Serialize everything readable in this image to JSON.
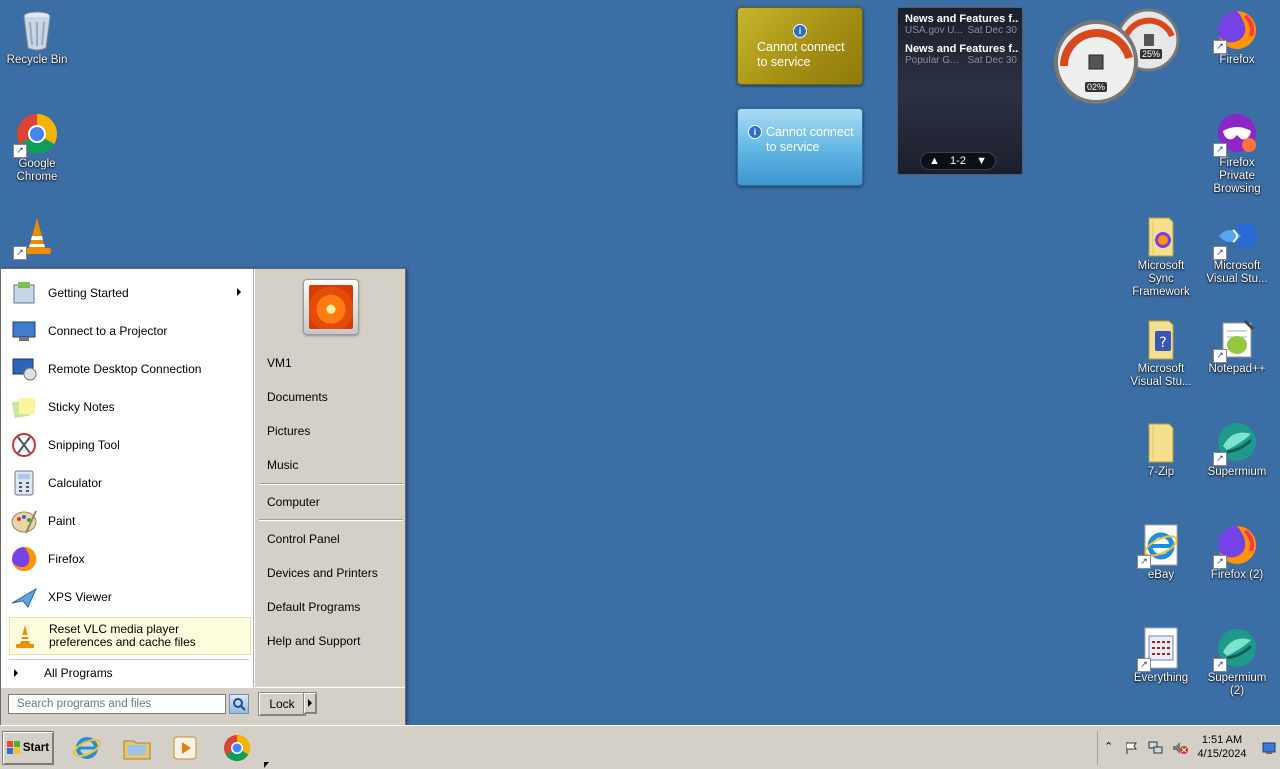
{
  "desktop": {
    "left_icons": [
      {
        "label": "Recycle Bin",
        "icon": "recycle-bin-icon"
      },
      {
        "label": "Google Chrome",
        "icon": "chrome-icon"
      },
      {
        "label": "VLC media player",
        "icon": "vlc-icon"
      }
    ],
    "right_icons": [
      {
        "label": "Firefox",
        "icon": "firefox-icon"
      },
      {
        "label": "Firefox Private Browsing",
        "icon": "firefox-private-icon"
      },
      {
        "label": "Microsoft Sync Framework",
        "icon": "folder-icon"
      },
      {
        "label": "Microsoft Visual Stu...",
        "icon": "visual-studio-icon"
      },
      {
        "label": "Microsoft Visual Stu...",
        "icon": "folder-help-icon"
      },
      {
        "label": "Notepad++",
        "icon": "notepadpp-icon"
      },
      {
        "label": "7-Zip",
        "icon": "folder-icon"
      },
      {
        "label": "Supermium",
        "icon": "supermium-icon"
      },
      {
        "label": "eBay",
        "icon": "ie-icon"
      },
      {
        "label": "Firefox (2)",
        "icon": "firefox-icon"
      },
      {
        "label": "Everything",
        "icon": "everything-icon"
      },
      {
        "label": "Supermium (2)",
        "icon": "supermium-icon"
      }
    ]
  },
  "gadgets": {
    "weather1": {
      "text": "Cannot connect to service"
    },
    "weather2": {
      "text": "Cannot connect to service"
    },
    "feed": {
      "items": [
        {
          "title": "News and Features f...",
          "source": "USA.gov U...",
          "date": "Sat Dec 30"
        },
        {
          "title": "News and Features f...",
          "source": "Popular G...",
          "date": "Sat Dec 30"
        }
      ],
      "pager": "1-2"
    },
    "meter": {
      "cpu": "02%",
      "memory": "25%"
    }
  },
  "start_menu": {
    "programs": [
      {
        "label": "Getting Started",
        "icon": "getting-started-icon",
        "has_submenu": true
      },
      {
        "label": "Connect to a Projector",
        "icon": "projector-icon"
      },
      {
        "label": "Remote Desktop Connection",
        "icon": "remote-desktop-icon"
      },
      {
        "label": "Sticky Notes",
        "icon": "sticky-notes-icon"
      },
      {
        "label": "Snipping Tool",
        "icon": "snipping-tool-icon"
      },
      {
        "label": "Calculator",
        "icon": "calculator-icon"
      },
      {
        "label": "Paint",
        "icon": "paint-icon"
      },
      {
        "label": "Firefox",
        "icon": "firefox-icon"
      },
      {
        "label": "XPS Viewer",
        "icon": "xps-viewer-icon"
      },
      {
        "label": "Reset VLC media player preferences and cache files",
        "icon": "vlc-icon",
        "highlighted": true
      }
    ],
    "all_programs": "All Programs",
    "search_placeholder": "Search programs and files",
    "right_items": [
      "VM1",
      "Documents",
      "Pictures",
      "Music",
      "Computer",
      "Control Panel",
      "Devices and Printers",
      "Default Programs",
      "Help and Support"
    ],
    "lock_label": "Lock"
  },
  "taskbar": {
    "start_label": "Start",
    "pinned": [
      "internet-explorer-icon",
      "file-explorer-icon",
      "media-player-icon",
      "chrome-icon"
    ],
    "clock_time": "1:51 AM",
    "clock_date": "4/15/2024"
  },
  "colors": {
    "desktop": "#3a6ea5",
    "taskbar": "#d4d0c8"
  }
}
